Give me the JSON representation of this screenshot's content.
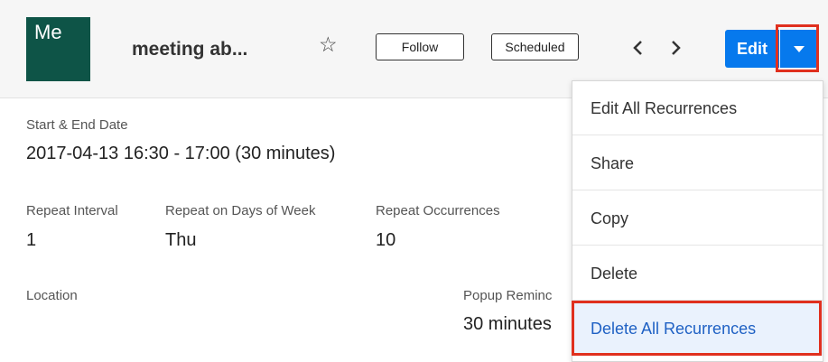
{
  "header": {
    "avatar_text": "Me",
    "title": "meeting ab...",
    "favorite_icon": "star-outline-icon",
    "follow_label": "Follow",
    "status_label": "Scheduled",
    "prev_icon": "chevron-left-icon",
    "next_icon": "chevron-right-icon",
    "edit_label": "Edit",
    "dropdown_icon": "caret-down-icon"
  },
  "details": {
    "start_end": {
      "label": "Start & End Date",
      "value": "2017-04-13 16:30 - 17:00 (30 minutes)"
    },
    "repeat_interval": {
      "label": "Repeat Interval",
      "value": "1"
    },
    "repeat_days": {
      "label": "Repeat on Days of Week",
      "value": "Thu"
    },
    "repeat_occurrences": {
      "label": "Repeat Occurrences",
      "value": "10"
    },
    "location": {
      "label": "Location"
    },
    "popup_reminder": {
      "label": "Popup Reminc",
      "value": "30 minutes"
    }
  },
  "menu": {
    "items": [
      {
        "label": "Edit All Recurrences"
      },
      {
        "label": "Share"
      },
      {
        "label": "Copy"
      },
      {
        "label": "Delete"
      },
      {
        "label": "Delete All Recurrences"
      }
    ]
  },
  "colors": {
    "brand_button": "#0679ed",
    "avatar": "#0e5447",
    "highlight": "#e0301e",
    "active_item_text": "#1f61c4"
  }
}
